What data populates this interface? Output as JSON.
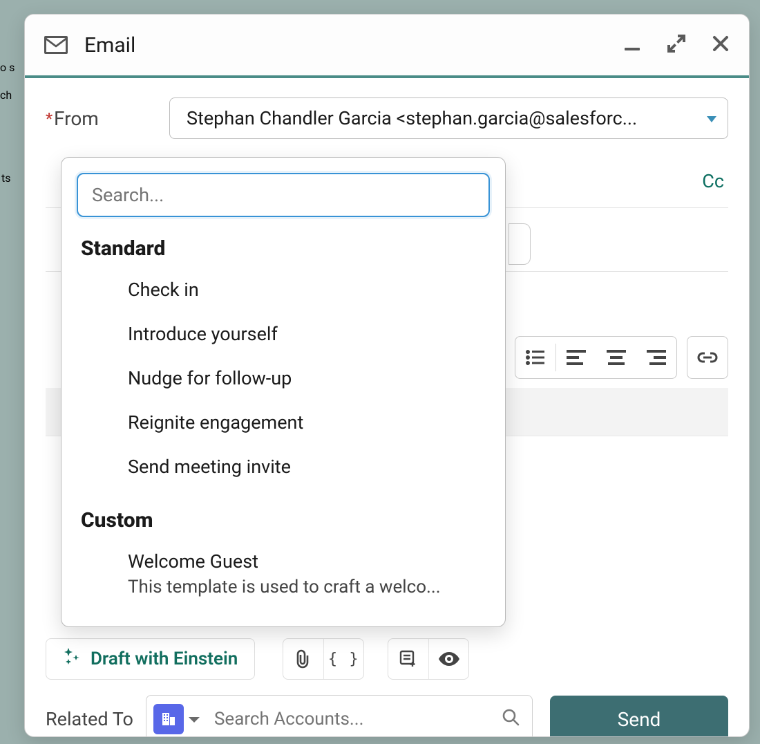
{
  "header": {
    "title": "Email"
  },
  "form": {
    "from_label": "From",
    "from_value": "Stephan Chandler Garcia <stephan.garcia@salesforc...",
    "cc_label": "Cc"
  },
  "template_popover": {
    "search_placeholder": "Search...",
    "sections": [
      {
        "title": "Standard",
        "items": [
          {
            "label": "Check in"
          },
          {
            "label": "Introduce yourself"
          },
          {
            "label": "Nudge for follow-up"
          },
          {
            "label": "Reignite engagement"
          },
          {
            "label": "Send meeting invite"
          }
        ]
      },
      {
        "title": "Custom",
        "items": [
          {
            "label": "Welcome Guest",
            "description": "This template is used to craft a welco..."
          }
        ]
      }
    ]
  },
  "einstein": {
    "draft_label": "Draft with Einstein"
  },
  "footer": {
    "related_label": "Related To",
    "related_placeholder": "Search Accounts...",
    "send_label": "Send"
  },
  "background_fragments": {
    "l1": "o s",
    "l2": "ch",
    "l3": "ts"
  }
}
